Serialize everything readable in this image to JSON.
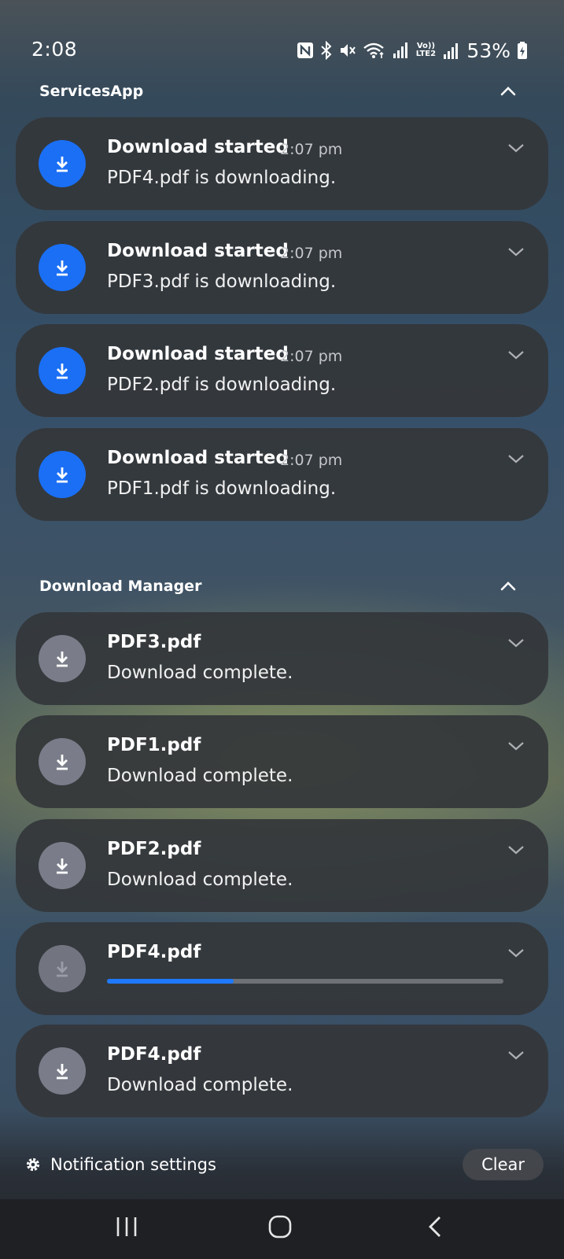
{
  "status_bar": {
    "time": "2:08",
    "battery": "53%",
    "icons": [
      "nfc-icon",
      "bluetooth-icon",
      "mute-icon",
      "wifi-icon",
      "signal-icon",
      "volte-icon",
      "signal-roaming-icon",
      "battery-charging-icon"
    ],
    "volte_label": "Vo)) LTE2",
    "roaming_label": "R"
  },
  "groups": [
    {
      "app": "ServicesApp",
      "notifications": [
        {
          "title": "Download started",
          "time": "2:07 pm",
          "text": "PDF4.pdf is downloading."
        },
        {
          "title": "Download started",
          "time": "2:07 pm",
          "text": "PDF3.pdf is downloading."
        },
        {
          "title": "Download started",
          "time": "2:07 pm",
          "text": "PDF2.pdf is downloading."
        },
        {
          "title": "Download started",
          "time": "2:07 pm",
          "text": "PDF1.pdf is downloading."
        }
      ]
    },
    {
      "app": "Download Manager",
      "notifications": [
        {
          "title": "PDF3.pdf",
          "text": "Download complete."
        },
        {
          "title": "PDF1.pdf",
          "text": "Download complete."
        },
        {
          "title": "PDF2.pdf",
          "text": "Download complete."
        },
        {
          "title": "PDF4.pdf",
          "progress": 0.32
        },
        {
          "title": "PDF4.pdf",
          "text": "Download complete."
        }
      ]
    }
  ],
  "footer": {
    "settings_label": "Notification settings",
    "clear_label": "Clear"
  },
  "colors": {
    "accent_blue": "#1a6ff5",
    "progress_fill": "#1e79ff",
    "card_bg": "#34373a"
  }
}
